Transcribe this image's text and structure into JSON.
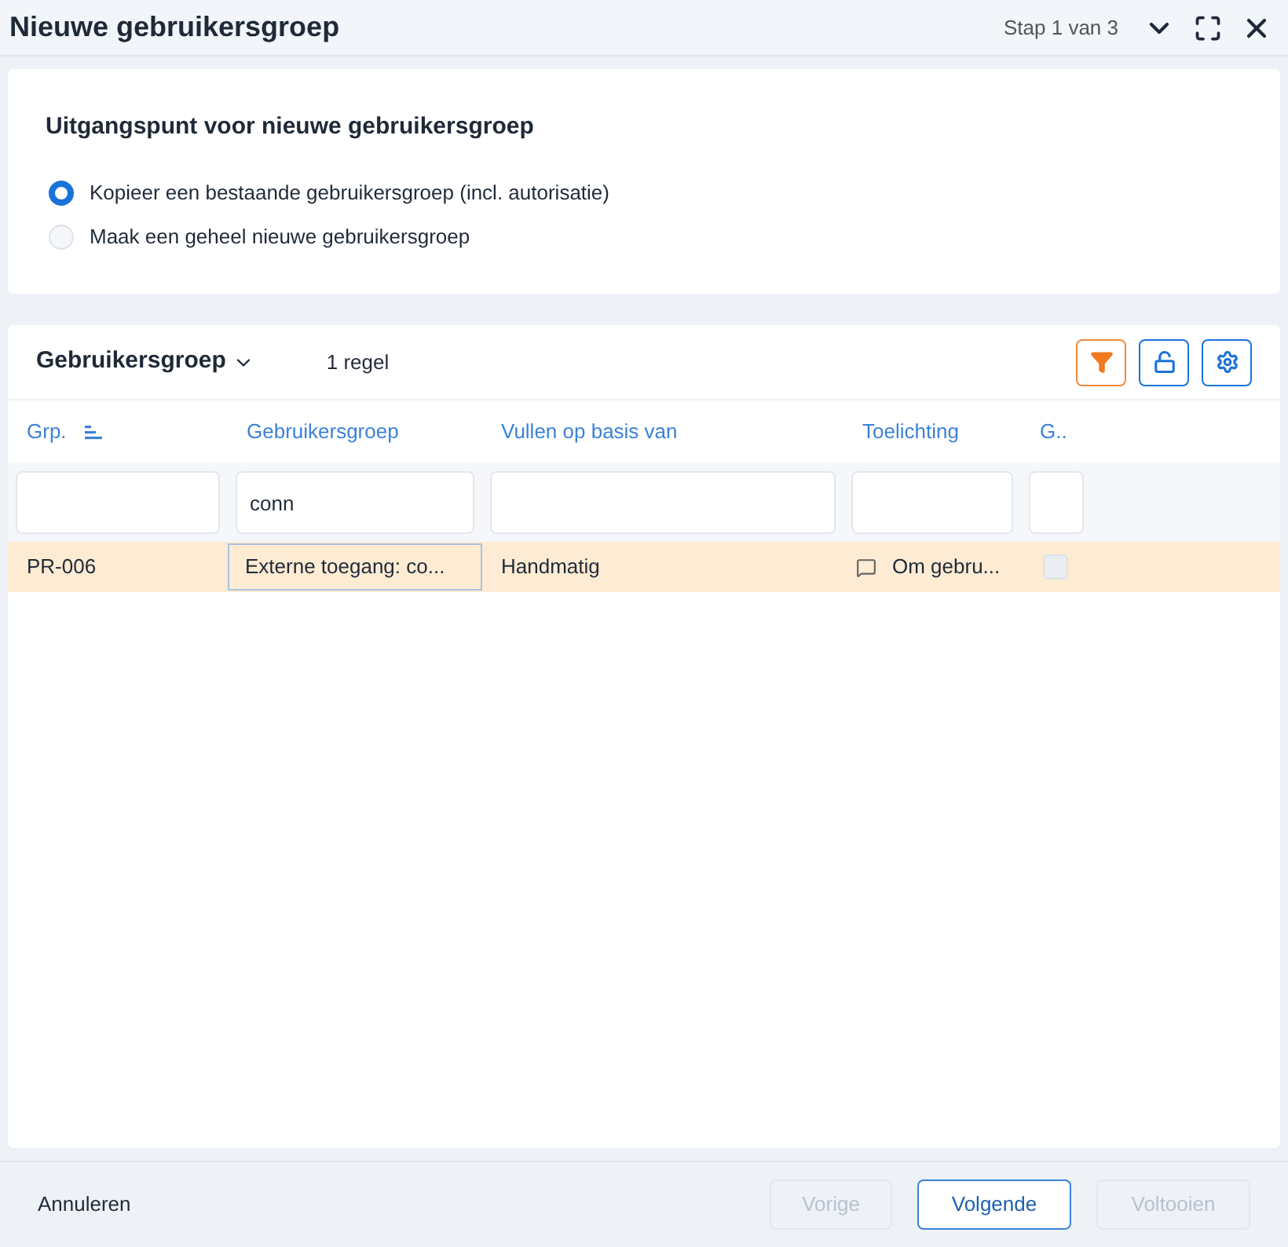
{
  "window": {
    "title": "Nieuwe gebruikersgroep",
    "step": "Stap 1 van 3"
  },
  "origin": {
    "heading": "Uitgangspunt voor nieuwe gebruikersgroep",
    "options": [
      {
        "label": "Kopieer een bestaande gebruikersgroep (incl. autorisatie)",
        "selected": true
      },
      {
        "label": "Maak een geheel nieuwe gebruikersgroep",
        "selected": false
      }
    ]
  },
  "table": {
    "title": "Gebruikersgroep",
    "count": "1 regel",
    "columns": [
      {
        "label": "Grp.",
        "sorted": true
      },
      {
        "label": "Gebruikersgroep",
        "sorted": false,
        "filter": "conn"
      },
      {
        "label": "Vullen op basis van",
        "sorted": false
      },
      {
        "label": "Toelichting",
        "sorted": false
      },
      {
        "label": "G..",
        "sorted": false
      }
    ],
    "rows": [
      {
        "selected": true,
        "cells": [
          {
            "kind": "text",
            "text": "PR-006"
          },
          {
            "kind": "focused",
            "text": "Externe toegang: co..."
          },
          {
            "kind": "text",
            "text": "Handmatig"
          },
          {
            "kind": "note",
            "text": "Om gebru..."
          },
          {
            "kind": "checkbox",
            "checked": false
          }
        ]
      }
    ]
  },
  "footer": {
    "cancel": "Annuleren",
    "buttons": [
      {
        "label": "Vorige",
        "disabled": true
      },
      {
        "label": "Volgende",
        "disabled": false
      },
      {
        "label": "Voltooien",
        "disabled": true
      }
    ]
  }
}
